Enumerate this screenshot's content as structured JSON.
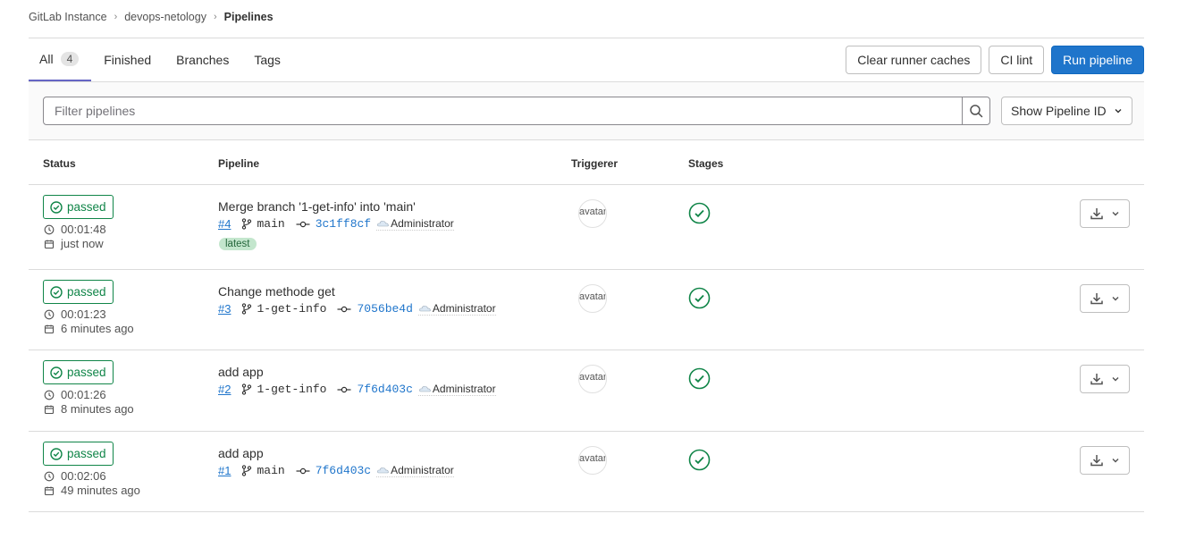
{
  "breadcrumb": [
    "GitLab Instance",
    "devops-netology",
    "Pipelines"
  ],
  "tabs": [
    {
      "label": "All",
      "count": "4"
    },
    {
      "label": "Finished"
    },
    {
      "label": "Branches"
    },
    {
      "label": "Tags"
    }
  ],
  "actions": {
    "clear_caches": "Clear runner caches",
    "ci_lint": "CI lint",
    "run_pipeline": "Run pipeline"
  },
  "filter": {
    "placeholder": "Filter pipelines",
    "show_id": "Show Pipeline ID"
  },
  "table": {
    "headers": [
      "Status",
      "Pipeline",
      "Triggerer",
      "Stages"
    ],
    "rows": [
      {
        "status": "passed",
        "duration": "00:01:48",
        "finished": "just now",
        "title": "Merge branch '1-get-info' into 'main'",
        "id": "#4",
        "branch": "main",
        "sha": "3c1ff8cf",
        "author": "Administrator",
        "tag": "latest",
        "avatar_alt": "avatar"
      },
      {
        "status": "passed",
        "duration": "00:01:23",
        "finished": "6 minutes ago",
        "title": "Change methode get",
        "id": "#3",
        "branch": "1-get-info",
        "sha": "7056be4d",
        "author": "Administrator",
        "avatar_alt": "avatar"
      },
      {
        "status": "passed",
        "duration": "00:01:26",
        "finished": "8 minutes ago",
        "title": "add app",
        "id": "#2",
        "branch": "1-get-info",
        "sha": "7f6d403c",
        "author": "Administrator",
        "avatar_alt": "avatar"
      },
      {
        "status": "passed",
        "duration": "00:02:06",
        "finished": "49 minutes ago",
        "title": "add app",
        "id": "#1",
        "branch": "main",
        "sha": "7f6d403c",
        "author": "Administrator",
        "avatar_alt": "avatar"
      }
    ]
  },
  "colors": {
    "success": "#108548",
    "primary": "#1f75cb",
    "tab_active": "#6666c4"
  }
}
